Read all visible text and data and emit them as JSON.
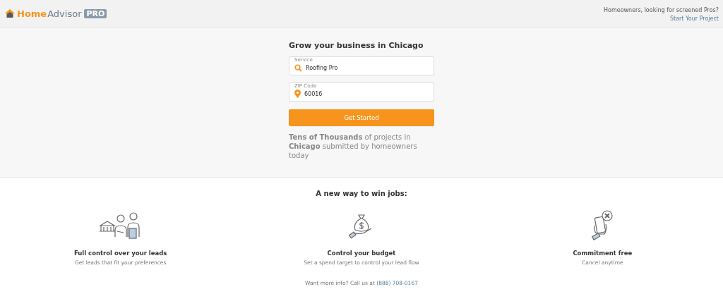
{
  "header": {
    "logo": {
      "part_1": "Home",
      "part_2": "Advisor",
      "badge": "PRO"
    },
    "prompt": "Homeowners, looking for screened Pros?",
    "link": "Start Your Project"
  },
  "hero": {
    "title": "Grow your business in Chicago",
    "fields": [
      {
        "kind": "search",
        "label": "Service",
        "value": "Roofing Pro"
      },
      {
        "kind": "location",
        "label": "ZIP Code",
        "value": "60016"
      }
    ],
    "button": "Get Started",
    "blurb": "**Tens of Thousands** of projects in **Chicago** submitted by homeowners today"
  },
  "features": {
    "title": "A new way to win jobs:",
    "items": [
      {
        "kind": "people",
        "title": "Full control over your leads",
        "text": "Get leads that fit your preferences"
      },
      {
        "kind": "money",
        "title": "Control your budget",
        "text": "Set a spend target to control your lead flow"
      },
      {
        "kind": "phone",
        "title": "Commitment free",
        "text": "Cancel anytime"
      }
    ]
  },
  "footer": {
    "text": "Want more info? Call us at",
    "phone": "(888) 708-0167"
  }
}
